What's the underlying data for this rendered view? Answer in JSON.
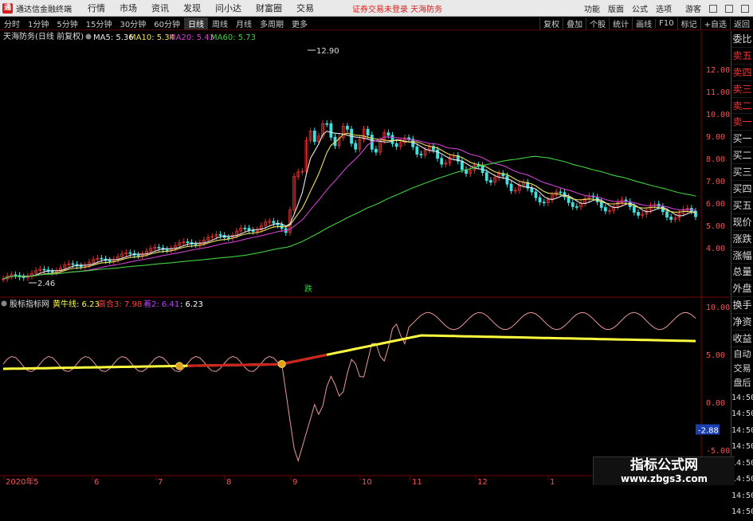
{
  "app": {
    "name": "通达信金融终端",
    "menu": [
      "行情",
      "市场",
      "资讯",
      "发现",
      "问小达",
      "财富圈",
      "交易"
    ],
    "notice": "证券交易未登录  天海防务",
    "right_menu": [
      "功能",
      "版面",
      "公式",
      "选项"
    ],
    "login": "游客"
  },
  "periods": [
    "分时",
    "1分钟",
    "5分钟",
    "15分钟",
    "30分钟",
    "60分钟",
    "日线",
    "周线",
    "月线",
    "多周期",
    "更多"
  ],
  "active_period": "日线",
  "toolbar_right": [
    "复权",
    "叠加",
    "个股",
    "统计",
    "画线",
    "F10",
    "标记",
    "+自选",
    "返回"
  ],
  "main_chart": {
    "title": "天海防务(日线 前复权)",
    "ma": [
      {
        "label": "MA5: 5.36",
        "color": "#e8e8e8"
      },
      {
        "label": "MA10: 5.34",
        "color": "#f0e060"
      },
      {
        "label": "MA20: 5.43",
        "color": "#d040d0"
      },
      {
        "label": "MA60: 5.73",
        "color": "#40d040"
      }
    ],
    "high_label": "12.90",
    "low_label": "2.46",
    "limit_marker": "跌",
    "y_ticks": [
      "12.00",
      "11.00",
      "10.00",
      "9.00",
      "8.00",
      "7.00",
      "6.00",
      "5.00",
      "4.00"
    ]
  },
  "indicator": {
    "title": "股标指标网",
    "items": [
      {
        "label": "黄牛线: 6.23",
        "color": "#ffff40"
      },
      {
        "label": "高合3: 7.98",
        "color": "#ff4040"
      },
      {
        "label": "着2: 6.41",
        "color": "#c040ff"
      },
      {
        "label": ": 6.23",
        "color": "#ffffff"
      }
    ],
    "y_ticks": [
      "10.00",
      "5.00",
      "0.00",
      "-5.00"
    ],
    "current_value": "-2.88"
  },
  "x_axis": [
    "2020年",
    "5",
    "6",
    "7",
    "8",
    "9",
    "10",
    "11",
    "12",
    "1",
    "2"
  ],
  "side_panel": {
    "items": [
      "委比",
      "卖五",
      "卖四",
      "卖三",
      "卖二",
      "卖一",
      "买一",
      "买二",
      "买三",
      "买四",
      "买五",
      "现价",
      "涨跌",
      "涨幅",
      "总量",
      "外盘",
      "换手",
      "净资",
      "收益"
    ],
    "labels": [
      "自动",
      "交易",
      "盘后"
    ],
    "times": [
      "14:50",
      "14:50",
      "14:50",
      "14:50",
      "14:50",
      "14:50",
      "14:50",
      "14:50"
    ]
  },
  "watermark": {
    "title": "指标公式网",
    "url": "www.zbgs3.com"
  },
  "colors": {
    "up": "#e03030",
    "down": "#40e0e0",
    "ma60": "#30c030",
    "ma20": "#c030c0"
  }
}
